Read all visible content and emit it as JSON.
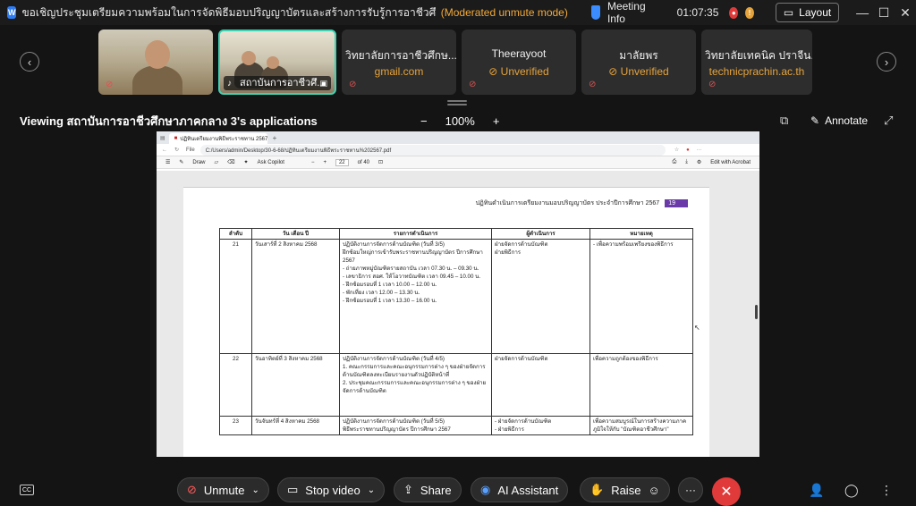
{
  "titlebar": {
    "app_logo": "webex-logo",
    "meeting_title": "ขอเชิญประชุมเตรียมความพร้อมในการจัดพิธีมอบปริญญาบัตรและสร้างการรับรู้การอาชีวศึกษา ระดับปริญญาตรี สายเท...",
    "mode": "(Moderated unmute mode)",
    "meeting_info": "Meeting Info",
    "time": "01:07:35",
    "layout": "Layout",
    "minimize": "—",
    "maximize": "☐",
    "close": "✕"
  },
  "participants": [
    {
      "name": "",
      "sub": "",
      "type": "video",
      "muted": true
    },
    {
      "name": "สถาบันการอาชีวศึ...",
      "sub": "",
      "type": "video-active",
      "muted": false
    },
    {
      "name": "วิทยาลัยการอาชีวศึกษ...",
      "sub": "gmail.com",
      "type": "text",
      "muted": true
    },
    {
      "name": "Theerayoot",
      "sub": "⊘ Unverified",
      "type": "text",
      "muted": true
    },
    {
      "name": "มาลัยพร",
      "sub": "⊘ Unverified",
      "type": "text",
      "muted": true
    },
    {
      "name": "วิทยาลัยเทคนิค ปราจีน...",
      "sub": "technicprachin.ac.th",
      "type": "text",
      "muted": true
    }
  ],
  "viewbar": {
    "viewing": "Viewing สถาบันการอาชีวศึกษาภาคกลาง 3's applications",
    "zoom_out": "−",
    "zoom": "100%",
    "zoom_in": "+",
    "annotate": "Annotate"
  },
  "browser": {
    "tab_title": "ปฏิทินเตรียมงานพิธีพระราชทาน 2567",
    "url": "C:/Users/admin/Desktop/30-6-68/ปฏิทินเตรียมงานพิธีพระราชทาน%202567.pdf",
    "file_label": "File",
    "draw_label": "Draw",
    "ask_copilot": "Ask Copilot",
    "page_current": "22",
    "page_total": "of 40",
    "edit_acrobat": "Edit with Acrobat"
  },
  "document": {
    "header": "ปฏิทินดำเนินการเตรียมงานมอบปริญญาบัตร ประจำปีการศึกษา 2567",
    "page_badge": "19",
    "columns": [
      "ลำดับ",
      "วัน เดือน ปี",
      "รายการดำเนินการ",
      "ผู้ดำเนินการ",
      "หมายเหตุ"
    ],
    "rows": [
      {
        "no": "21",
        "date": "วันเสาร์ที่ 2 สิงหาคม 2568",
        "detail": "ปฏิบัติงานการจัดการด้านบัณฑิต (วันที่ 3/5)\nฝึกซ้อมใหญ่การเข้ารับพระราชทานปริญญาบัตร ปีการศึกษา 2567\n-  ถ่ายภาพหมู่บัณฑิตรายสถาบัน เวลา 07.30 น. – 09.30 น.\n-  เลขาธิการ สอศ. ให้โอวาทบัณฑิต เวลา 09.45 – 10.00 น.\n-  ฝึกซ้อมรอบที่ 1 เวลา 10.00 – 12.00 น.\n-  พักเที่ยง เวลา 12.00 – 13.30 น.\n-  ฝึกซ้อมรอบที่ 1 เวลา 13.30 – 16.00 น.",
        "by": "ฝ่ายจัดการด้านบัณฑิต\nฝ่ายพิธีการ",
        "note": "- เพื่อความพร้อมเพรียงของพิธีการ"
      },
      {
        "no": "22",
        "date": "วันอาทิตย์ที่ 3 สิงหาคม 2568",
        "detail": "ปฏิบัติงานการจัดการด้านบัณฑิต (วันที่ 4/5)\n1. คณะกรรมการและคณะอนุกรรมการต่าง ๆ ของฝ่ายจัดการด้านบัณฑิตลงทะเบียนรายงานตัวปฏิบัติหน้าที่\n2. ประชุมคณะกรรมการและคณะอนุกรรมการต่าง ๆ ของฝ่ายจัดการด้านบัณฑิต",
        "by": "ฝ่ายจัดการด้านบัณฑิต",
        "note": "เพื่อความถูกต้องของพิธีการ"
      },
      {
        "no": "23",
        "date": "วันจันทร์ที่ 4 สิงหาคม 2568",
        "detail": "ปฏิบัติงานการจัดการด้านบัณฑิต (วันที่ 5/5)\nพิธีพระราชทานปริญญาบัตร ปีการศึกษา 2567",
        "by": "- ฝ่ายจัดการด้านบัณฑิต\n- ฝ่ายพิธีการ",
        "note": "เพื่อความสมบูรณ์ในการสร้างความภาคภูมิใจให้กับ \"บัณฑิตอาชีวศึกษา\""
      }
    ]
  },
  "controls": {
    "cc": "CC",
    "unmute": "Unmute",
    "stop_video": "Stop video",
    "share": "Share",
    "ai_assistant": "AI Assistant",
    "raise": "Raise",
    "more": "···",
    "end": "✕"
  },
  "colors": {
    "accent_mode": "#f2a93b",
    "active_border": "#3fd3b3",
    "end_call": "#e03a3a",
    "muted_red": "#e05050",
    "page_badge": "#6a3aa8"
  }
}
